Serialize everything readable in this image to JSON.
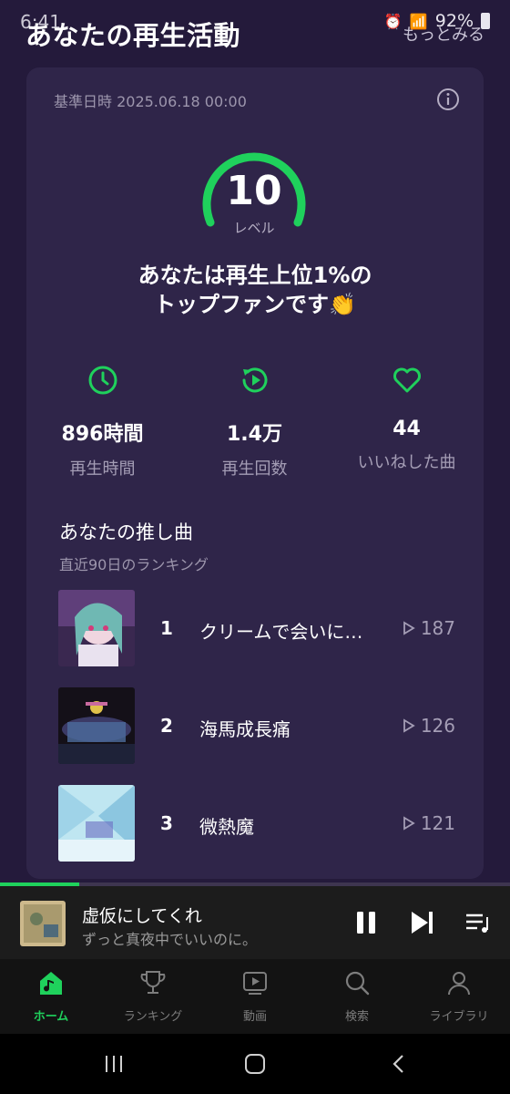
{
  "status_bar": {
    "time": "6:41",
    "battery": "92%"
  },
  "header": {
    "title": "あなたの再生活動",
    "more_label": "もっとみる"
  },
  "card": {
    "ref_date": "基準日時 2025.06.18 00:00",
    "level": {
      "value": "10",
      "label": "レベル"
    },
    "headline_line1": "あなたは再生上位1%の",
    "headline_line2": "トップファンです👏",
    "stats": [
      {
        "icon": "clock-icon",
        "value": "896時間",
        "label": "再生時間"
      },
      {
        "icon": "replay-icon",
        "value": "1.4万",
        "label": "再生回数"
      },
      {
        "icon": "heart-icon",
        "value": "44",
        "label": "いいねした曲"
      }
    ],
    "favorites": {
      "title": "あなたの推し曲",
      "subtitle": "直近90日のランキング",
      "tracks": [
        {
          "rank": "1",
          "title": "クリームで会いに…",
          "plays": "187"
        },
        {
          "rank": "2",
          "title": "海馬成長痛",
          "plays": "126"
        },
        {
          "rank": "3",
          "title": "微熱魔",
          "plays": "121"
        }
      ]
    }
  },
  "player": {
    "title": "虚仮にしてくれ",
    "artist": "ずっと真夜中でいいのに。",
    "progress": 0.155
  },
  "nav": [
    {
      "label": "ホーム",
      "icon": "home-icon",
      "active": true
    },
    {
      "label": "ランキング",
      "icon": "trophy-icon",
      "active": false
    },
    {
      "label": "動画",
      "icon": "video-icon",
      "active": false
    },
    {
      "label": "検索",
      "icon": "search-icon",
      "active": false
    },
    {
      "label": "ライブラリ",
      "icon": "person-icon",
      "active": false
    }
  ],
  "colors": {
    "accent": "#1fd15c",
    "background": "#241a3b",
    "card": "#2f2549"
  }
}
